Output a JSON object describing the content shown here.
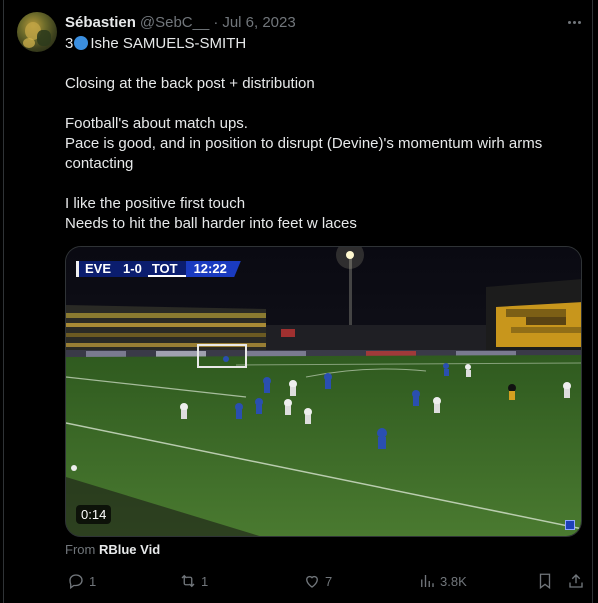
{
  "tweet": {
    "author_name": "Sébastien",
    "author_handle": "@SebC__",
    "separator": "·",
    "date": "Jul 6, 2023",
    "lines": [
      "Ishe SAMUELS-SMITH",
      "",
      "Closing at the back post + distribution",
      "",
      "Football's about match ups.",
      "Pace is good, and in position to disrupt (Devine)'s momentum wirh arms",
      "contacting",
      "",
      "I like the positive first touch",
      "Needs to hit the ball harder into feet w laces"
    ],
    "first_line_prefix": "3"
  },
  "video": {
    "scoreboard": {
      "home": "EVE",
      "score": "1-0",
      "away": "TOT",
      "clock": "12:22"
    },
    "duration": "0:14"
  },
  "source": {
    "prefix": "From",
    "name": "RBlue Vid"
  },
  "actions": {
    "replies": "1",
    "reposts": "1",
    "likes": "7",
    "views": "3.8K"
  },
  "colors": {
    "background": "#000000",
    "text": "#e7e9ea",
    "secondary_text": "#71767b",
    "border": "#2f3336",
    "pitch": "#3d6a2a"
  }
}
